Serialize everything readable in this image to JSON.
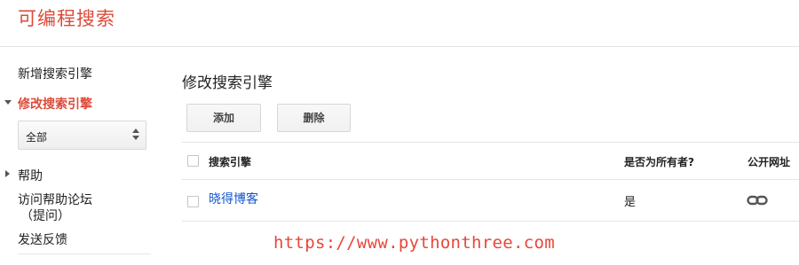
{
  "header": {
    "title": "可编程搜索"
  },
  "sidebar": {
    "items": [
      {
        "label": "新增搜索引擎"
      },
      {
        "label": "修改搜索引擎",
        "active": true
      },
      {
        "label": "帮助"
      },
      {
        "label": "访问帮助论坛"
      },
      {
        "label": "（提问）"
      },
      {
        "label": "发送反馈"
      }
    ],
    "select": {
      "value": "全部"
    }
  },
  "main": {
    "title": "修改搜索引擎",
    "buttons": {
      "add": "添加",
      "delete": "删除"
    },
    "table": {
      "headers": {
        "engine": "搜索引擎",
        "owner": "是否为所有者?",
        "public_url": "公开网址"
      },
      "rows": [
        {
          "engine": "晓得博客",
          "owner": "是",
          "public_url_icon": "link-icon"
        }
      ]
    }
  },
  "watermark": "https://www.pythonthree.com",
  "colors": {
    "accent": "#dd4b39",
    "link": "#1155cc",
    "watermark": "#e8463a"
  }
}
